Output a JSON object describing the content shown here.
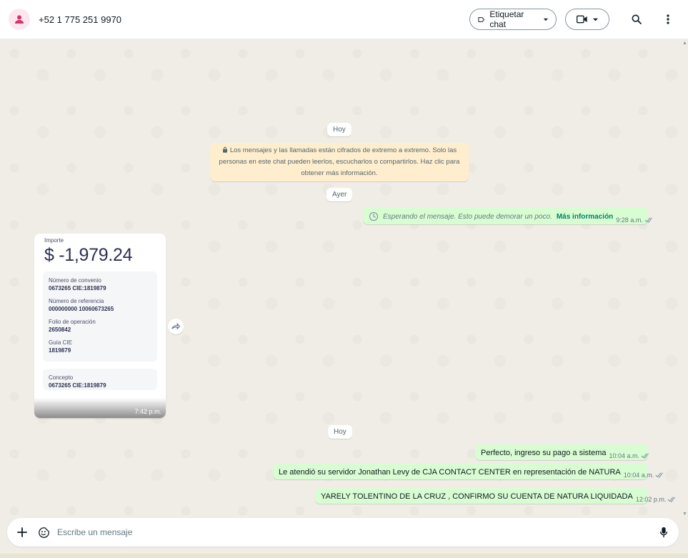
{
  "header": {
    "contact_name": "+52 1 775 251 9970",
    "label_chat": "Etiquetar chat"
  },
  "chat": {
    "date_today_1": "Hoy",
    "encryption_notice": "Los mensajes y las llamadas están cifrados de extremo a extremo. Solo las personas en este chat pueden leerlos, escucharlos o compartirlos. Haz clic para obtener más información.",
    "date_yesterday": "Ayer",
    "waiting": {
      "text": "Esperando el mensaje. Esto puede demorar un poco.",
      "more": "Más información",
      "time": "9:28 a.m."
    },
    "receipt": {
      "importe_label": "Importe",
      "amount": "$ -1,979.24",
      "fields": [
        {
          "key": "Número de convenio",
          "value": "0673265 CIE:1819879"
        },
        {
          "key": "Número de referencia",
          "value": "000000000 10060673265"
        },
        {
          "key": "Folio de operación",
          "value": "2650842"
        },
        {
          "key": "Guía CIE",
          "value": "1819879"
        }
      ],
      "concepto_label": "Concepto",
      "concepto_value": "0673265 CIE:1819879",
      "time": "7:42 p.m."
    },
    "date_today_2": "Hoy",
    "messages": [
      {
        "text": "Perfecto, ingreso su pago a sistema",
        "time": "10:04 a.m."
      },
      {
        "text": "Le atendió su servidor Jonathan Levy de CJA CONTACT CENTER en representación de NATURA",
        "time": "10:04 a.m."
      },
      {
        "text": "YARELY TOLENTINO DE LA CRUZ , CONFIRMO SU CUENTA DE NATURA LIQUIDADA",
        "time": "12:02 p.m."
      }
    ]
  },
  "composer": {
    "placeholder": "Escribe un mensaje"
  },
  "colors": {
    "outgoing_bubble": "#d9fdd3",
    "notice_bg": "#ffeecd",
    "accent": "#008069"
  }
}
